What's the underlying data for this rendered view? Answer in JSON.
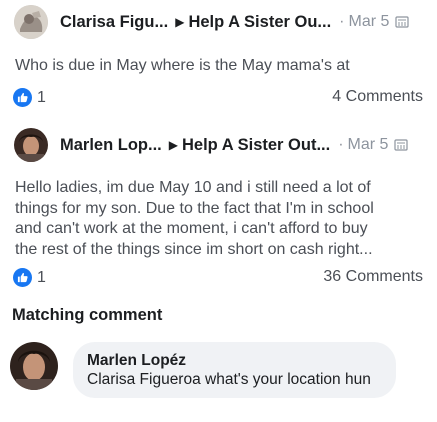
{
  "posts": [
    {
      "author": "Clarisa Figu...",
      "group": "Help A Sister Ou...",
      "date": "Mar 5",
      "text": "Who is due in May where is the May mama's at",
      "likes": "1",
      "comments": "4 Comments"
    },
    {
      "author": "Marlen Lop...",
      "group": "Help A Sister Out...",
      "date": "Mar 5",
      "text": "Hello ladies, im due May 10 and i still need a lot of\nthings for my son. Due to the fact that I'm in school\nand can't work at the moment, i can't afford to buy\nthe rest of the things since im short on cash right...",
      "likes": "1",
      "comments": "36 Comments"
    }
  ],
  "separator_glyph": "▶",
  "dot_glyph": "·",
  "section_title": "Matching comment",
  "comment": {
    "author": "Marlen Lopéz",
    "text": "Clarisa Figueroa what's your location hun"
  },
  "colors": {
    "like_blue": "#1877f2",
    "bubble_bg": "#f0f2f5",
    "meta_gray": "#8d949e"
  },
  "icons": [
    "globe-icon",
    "like-icon",
    "avatar"
  ]
}
